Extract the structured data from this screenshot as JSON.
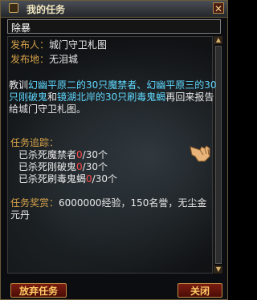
{
  "window": {
    "title": "我的任务",
    "close": "✕"
  },
  "quest_name": "除暴",
  "publisher": {
    "label": "发布人：",
    "value": "城门守卫札图"
  },
  "location": {
    "label": "发布地：",
    "value": "无泪城"
  },
  "description": {
    "p1": "教训",
    "p2": "幻幽平原二的30只魔禁者、幻幽平原三的30只刚破鬼",
    "p3": "和",
    "p4": "镜湖北岸的30只刷毒鬼蝎",
    "p5": "再回来报告给城门守卫札图。"
  },
  "tracking": {
    "label": "任务追踪：",
    "items": [
      {
        "prefix": "已杀死魔禁者",
        "count": "0",
        "total": "/30个"
      },
      {
        "prefix": "已杀死刚破鬼",
        "count": "0",
        "total": "/30个"
      },
      {
        "prefix": "已杀死刷毒鬼蝎",
        "count": "0",
        "total": "/30个"
      }
    ]
  },
  "reward": {
    "label": "任务奖赏：",
    "value": "6000000经验，150名誉，无尘金元丹"
  },
  "buttons": {
    "abandon": "放弃任务",
    "close": "关闭"
  },
  "colors": {
    "label": "#d6a24a",
    "highlight": "#5fd9ff",
    "count": "#ff4a4a",
    "button_text": "#ffcc66"
  }
}
